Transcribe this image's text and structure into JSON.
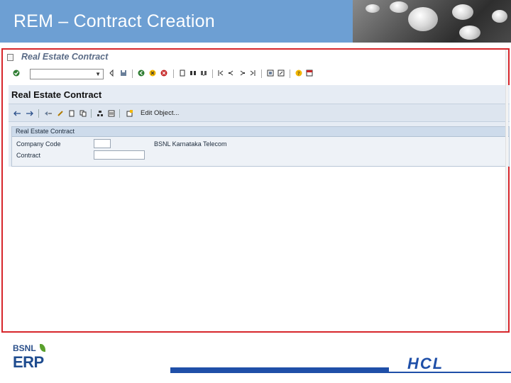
{
  "slide": {
    "title": "REM – Contract  Creation"
  },
  "sap_window": {
    "menu_title": "Real Estate Contract",
    "command_field": {
      "value": ""
    },
    "screen_title": "Real Estate Contract",
    "app_toolbar": {
      "edit_object_label": "Edit Object..."
    },
    "group": {
      "title": "Real Estate Contract",
      "company_code_label": "Company Code",
      "company_code_value": "",
      "company_code_desc": "BSNL  Karnataka Telecom",
      "contract_label": "Contract",
      "contract_value": ""
    }
  },
  "footer": {
    "bsnl_logo_text": "BSNL",
    "erp_logo_text": "ERP",
    "hcl_logo_text": "HCL"
  },
  "colors": {
    "banner": "#6d9fd3",
    "frame_border": "#d7262b",
    "hcl_blue": "#1f4fa8"
  }
}
